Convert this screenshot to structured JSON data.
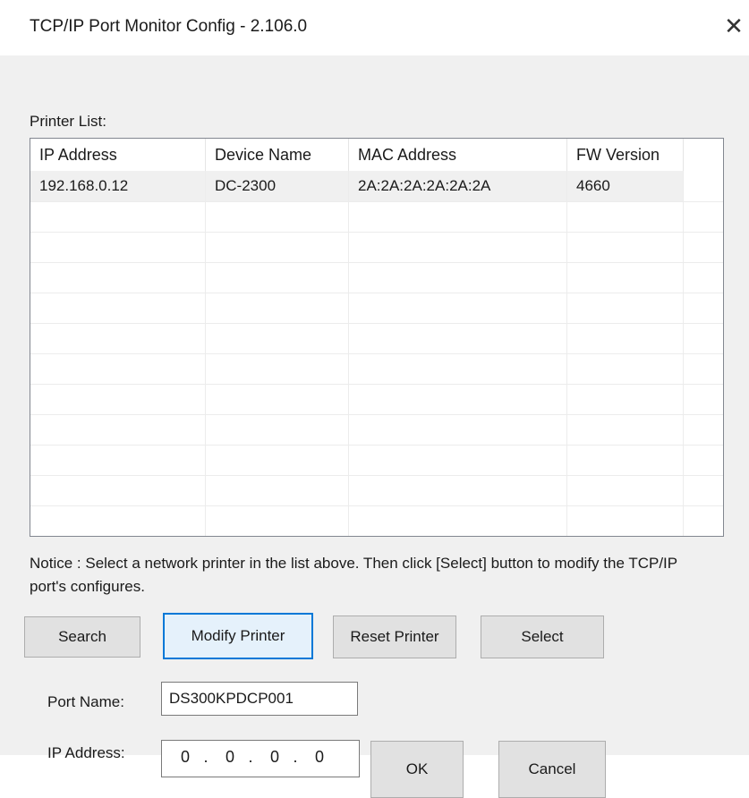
{
  "window": {
    "title": "TCP/IP Port Monitor Config - 2.106.0",
    "close_glyph": "✕"
  },
  "printer_list": {
    "label": "Printer List:",
    "columns": [
      "IP Address",
      "Device Name",
      "MAC Address",
      "FW Version"
    ],
    "rows": [
      [
        "192.168.0.12",
        "DC-2300",
        "2A:2A:2A:2A:2A:2A",
        "4660"
      ]
    ]
  },
  "notice": "Notice : Select a network printer in the list above. Then click [Select] button to modify the TCP/IP port's configures.",
  "buttons": {
    "search": "Search",
    "modify_printer": "Modify Printer",
    "reset_printer": "Reset Printer",
    "select": "Select",
    "ok": "OK",
    "cancel": "Cancel"
  },
  "port_name": {
    "label": "Port Name:",
    "value": "DS300KPDCP001"
  },
  "ip_address": {
    "label": "IP Address:",
    "octets": [
      "0",
      "0",
      "0",
      "0"
    ]
  },
  "colors": {
    "focus_border": "#0078d7",
    "dialog_bg": "#f0f0f0"
  }
}
